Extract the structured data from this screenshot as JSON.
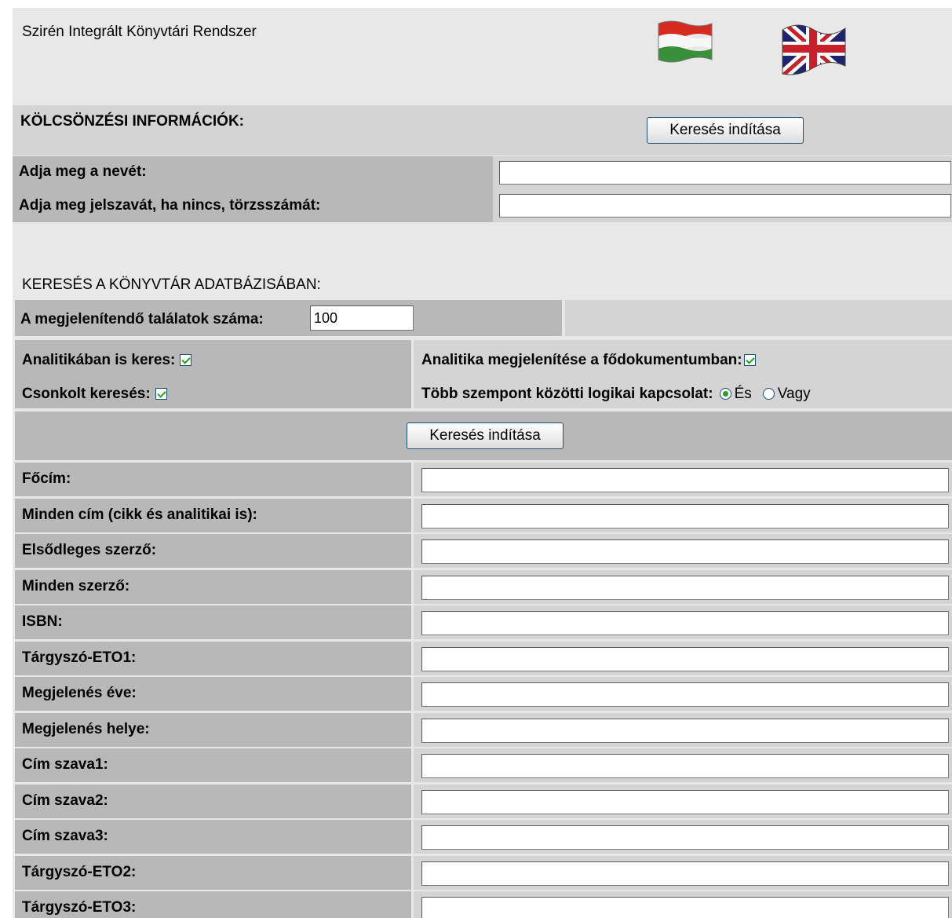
{
  "app": {
    "title": "Szirén Integrált Könyvtári Rendszer"
  },
  "languages": [
    {
      "code": "hu",
      "icon": "hungarian-flag-icon"
    },
    {
      "code": "en",
      "icon": "uk-flag-icon"
    }
  ],
  "loan": {
    "heading": "KÖLCSÖNZÉSI INFORMÁCIÓK:",
    "search_button": "Keresés indítása",
    "name_label": "Adja meg a nevét:",
    "name_value": "",
    "password_label": "Adja meg jelszavát, ha nincs, törzsszámát:",
    "password_value": ""
  },
  "search": {
    "heading": "KERESÉS A KÖNYVTÁR ADATBÁZISÁBAN:",
    "results_label": "A megjelenítendő találatok száma:",
    "results_value": "100",
    "analytics_label": "Analitikában is keres:",
    "analytics_checked": true,
    "analytics_display_label": "Analitika megjelenítése a fődokumentumban:",
    "analytics_display_checked": true,
    "truncated_label": "Csonkolt keresés:",
    "truncated_checked": true,
    "logic_label": "Több szempont közötti logikai kapcsolat:",
    "logic_and": "És",
    "logic_or": "Vagy",
    "logic_selected": "És",
    "search_button": "Keresés indítása",
    "fields": [
      {
        "label": "Főcím:",
        "value": ""
      },
      {
        "label": "Minden cím (cikk és analitikai is):",
        "value": ""
      },
      {
        "label": "Elsődleges szerző:",
        "value": ""
      },
      {
        "label": "Minden szerző:",
        "value": ""
      },
      {
        "label": "ISBN:",
        "value": ""
      },
      {
        "label": "Tárgyszó-ETO1:",
        "value": ""
      },
      {
        "label": "Megjelenés éve:",
        "value": ""
      },
      {
        "label": "Megjelenés helye:",
        "value": ""
      },
      {
        "label": "Cím szava1:",
        "value": ""
      },
      {
        "label": "Cím szava2:",
        "value": ""
      },
      {
        "label": "Cím szava3:",
        "value": ""
      },
      {
        "label": "Tárgyszó-ETO2:",
        "value": ""
      },
      {
        "label": "Tárgyszó-ETO3:",
        "value": ""
      }
    ]
  }
}
